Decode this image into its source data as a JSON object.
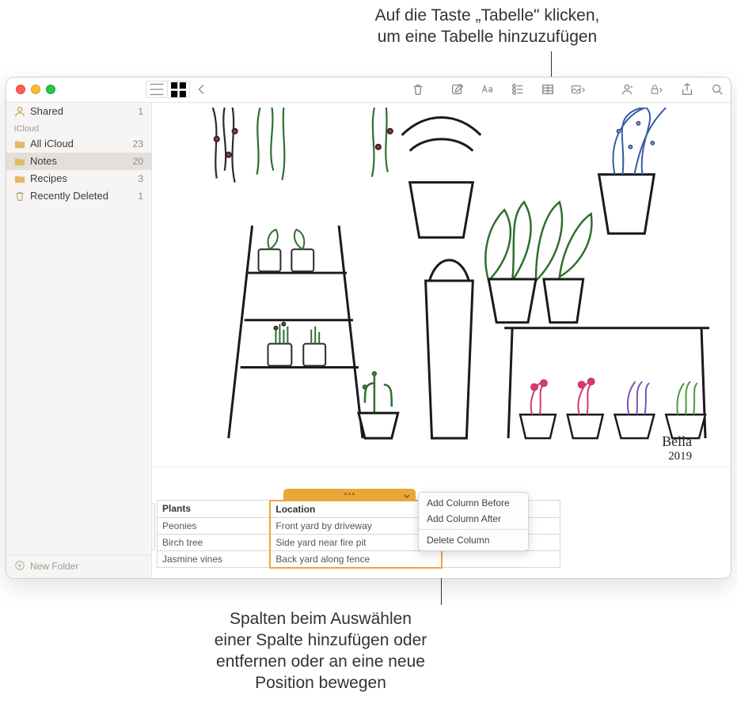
{
  "callouts": {
    "top": "Auf die Taste „Tabelle\" klicken,\num eine Tabelle hinzuzufügen",
    "bottom": "Spalten beim Auswählen\neiner Spalte hinzufügen oder\nentfernen oder an eine neue\nPosition bewegen"
  },
  "sidebar": {
    "shared": {
      "label": "Shared",
      "count": "1"
    },
    "section_header": "iCloud",
    "items": [
      {
        "label": "All iCloud",
        "count": "23",
        "selected": false
      },
      {
        "label": "Notes",
        "count": "20",
        "selected": true
      },
      {
        "label": "Recipes",
        "count": "3",
        "selected": false
      }
    ],
    "deleted": {
      "label": "Recently Deleted",
      "count": "1"
    },
    "new_folder": "New Folder"
  },
  "drawing_signature": "Bella\n2019",
  "table": {
    "headers": [
      "Plants",
      "Location"
    ],
    "rows": [
      [
        "Peonies",
        "Front yard by driveway"
      ],
      [
        "Birch tree",
        "Side yard near fire pit"
      ],
      [
        "Jasmine vines",
        "Back yard along fence"
      ]
    ]
  },
  "context_menu": {
    "items": [
      "Add Column Before",
      "Add Column After"
    ],
    "sep_items": [
      "Delete Column"
    ]
  },
  "toolbar_icons": {
    "list_view": "list-view",
    "grid_view": "grid-view",
    "back": "back",
    "trash": "trash",
    "compose": "compose",
    "format": "format",
    "checklist": "checklist",
    "table": "table",
    "media": "media",
    "tag": "tag",
    "lock": "lock",
    "share": "share",
    "search": "search"
  }
}
